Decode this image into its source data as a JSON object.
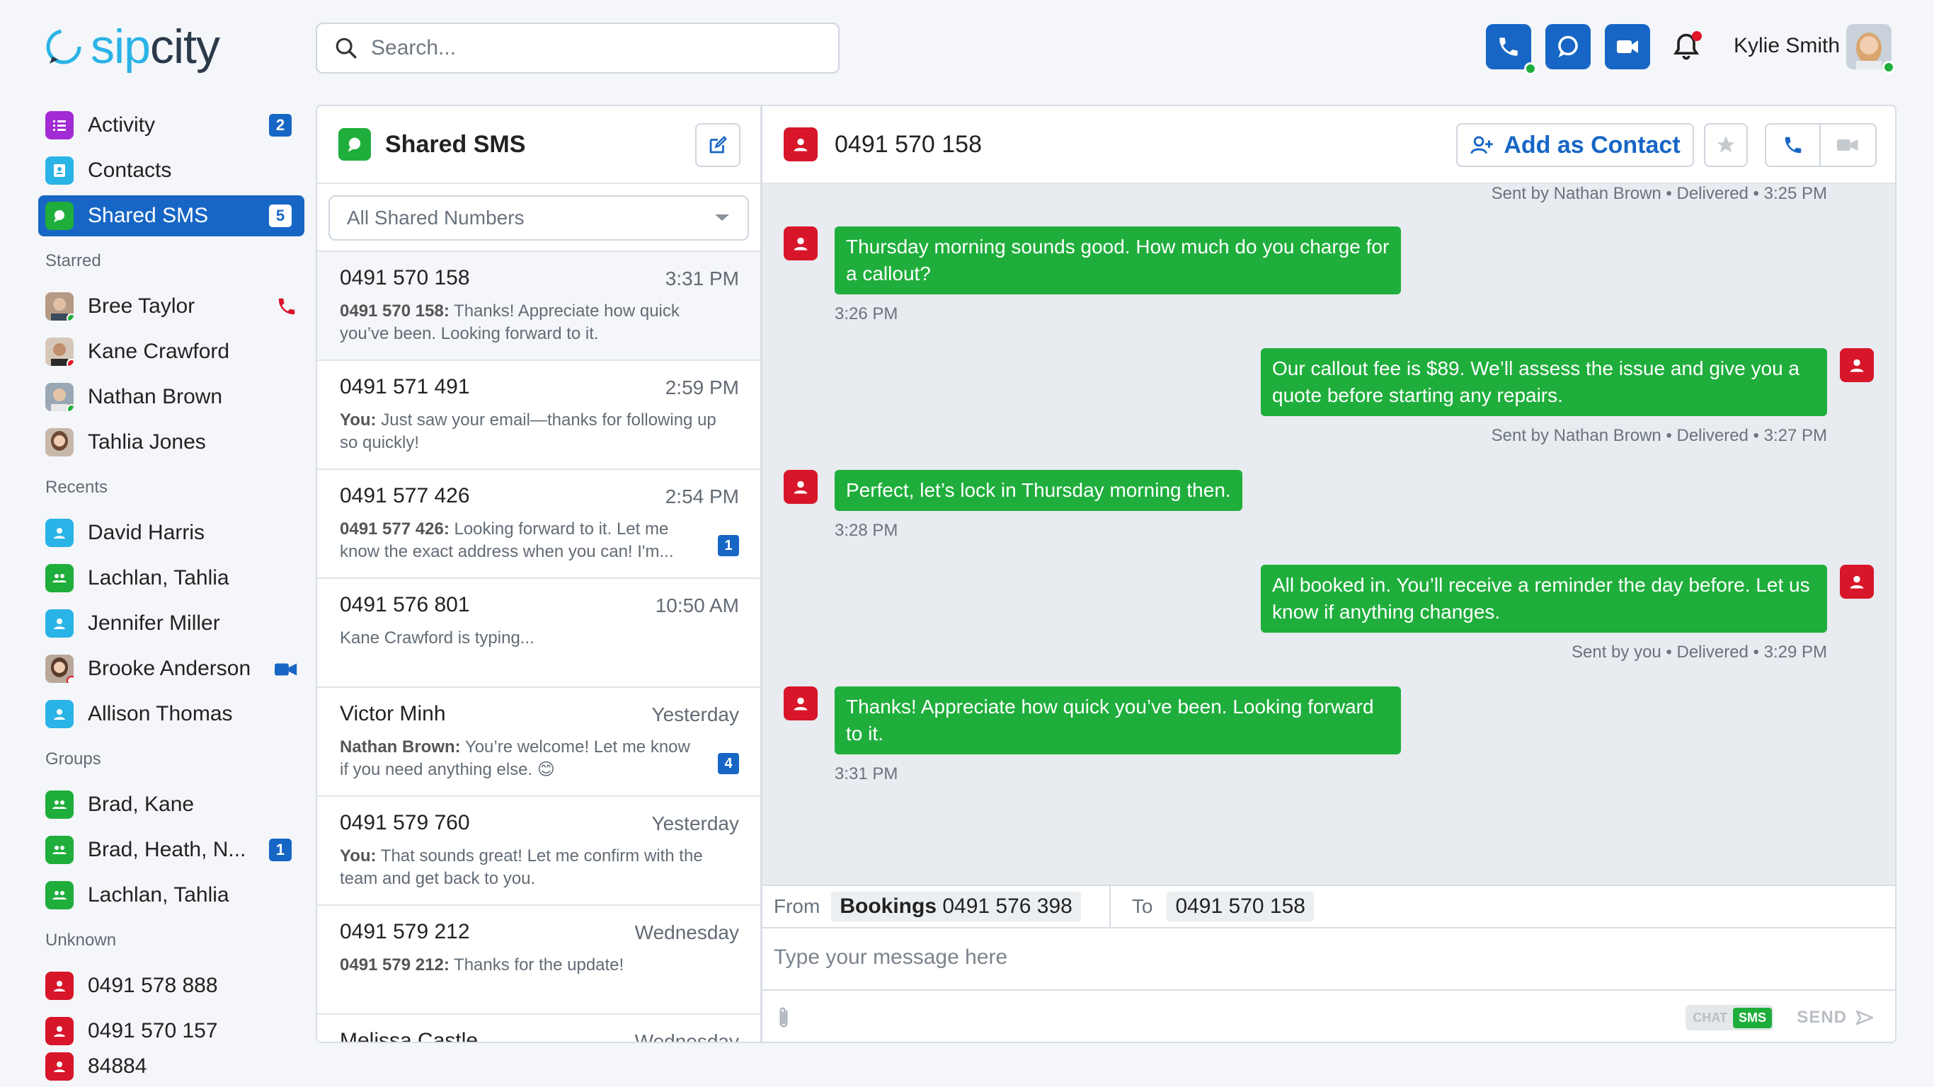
{
  "app": {
    "brand_prefix": "sip",
    "brand_suffix": "city"
  },
  "search": {
    "placeholder": "Search..."
  },
  "user": {
    "name": "Kylie Smith"
  },
  "colors": {
    "primary": "#1766c5",
    "green": "#1fae3c",
    "red": "#d8162a",
    "purple": "#a22bd6",
    "cyan": "#2ab3e6"
  },
  "sidebar": {
    "nav": [
      {
        "label": "Activity",
        "badge": "2",
        "icon": "activity-icon"
      },
      {
        "label": "Contacts",
        "icon": "contacts-icon"
      },
      {
        "label": "Shared SMS",
        "badge": "5",
        "icon": "shared-sms-icon"
      }
    ],
    "starred_heading": "Starred",
    "starred": [
      {
        "label": "Bree Taylor",
        "status": "online",
        "status_icon": "phone-icon"
      },
      {
        "label": "Kane Crawford",
        "status": "busy"
      },
      {
        "label": "Nathan Brown",
        "status": "online"
      },
      {
        "label": "Tahlia Jones",
        "status": "none"
      }
    ],
    "recents_heading": "Recents",
    "recents": [
      {
        "label": "David Harris",
        "icon": "person-icon"
      },
      {
        "label": "Lachlan, Tahlia",
        "icon": "group-icon"
      },
      {
        "label": "Jennifer Miller",
        "icon": "person-icon"
      },
      {
        "label": "Brooke Anderson",
        "icon": "avatar",
        "status_icon": "video-icon"
      },
      {
        "label": "Allison Thomas",
        "icon": "person-icon"
      }
    ],
    "groups_heading": "Groups",
    "groups": [
      {
        "label": "Brad, Kane"
      },
      {
        "label": "Brad, Heath, N...",
        "badge": "1"
      },
      {
        "label": "Lachlan, Tahlia"
      }
    ],
    "unknown_heading": "Unknown",
    "unknown": [
      {
        "label": "0491 578 888"
      },
      {
        "label": "0491 570 157"
      },
      {
        "label": "84884"
      }
    ]
  },
  "list": {
    "title": "Shared SMS",
    "filter": "All Shared Numbers",
    "conversations": [
      {
        "number": "0491 570 158",
        "time": "3:31 PM",
        "sender": "0491 570 158:",
        "text": "Thanks! Appreciate how quick you’ve been. Looking forward to it.",
        "selected": true
      },
      {
        "number": "0491 571 491",
        "time": "2:59 PM",
        "sender": "You:",
        "text": "Just saw your email—thanks for following up so quickly!"
      },
      {
        "number": "0491 577 426",
        "time": "2:54 PM",
        "sender": "0491 577 426:",
        "text": "Looking forward to it. Let me know the exact address when you can! I'm...",
        "badge": "1"
      },
      {
        "number": "0491 576 801",
        "time": "10:50 AM",
        "sender": "",
        "text": "Kane Crawford is typing..."
      },
      {
        "number": "Victor Minh",
        "time": "Yesterday",
        "sender": "Nathan Brown:",
        "text": "You’re welcome! Let me know if you need anything else. 😊",
        "badge": "4"
      },
      {
        "number": "0491 579 760",
        "time": "Yesterday",
        "sender": "You:",
        "text": "That sounds great! Let me confirm with the team and get back to you."
      },
      {
        "number": "0491 579 212",
        "time": "Wednesday",
        "sender": "0491 579 212:",
        "text": "Thanks for the update!"
      },
      {
        "number": "Melissa Castle",
        "time": "Wednesday",
        "sender": "",
        "text": ""
      }
    ]
  },
  "chat": {
    "title": "0491 570 158",
    "add_contact": "Add as Contact",
    "top_meta": "Sent by Nathan Brown • Delivered • 3:25 PM",
    "messages": [
      {
        "dir": "in",
        "text": "Thursday morning sounds good. How much do you charge for a callout?",
        "meta": "3:26 PM"
      },
      {
        "dir": "out",
        "text": "Our callout fee is $89. We’ll assess the issue and give you a quote before starting any repairs.",
        "meta": "Sent by Nathan Brown • Delivered • 3:27 PM"
      },
      {
        "dir": "in",
        "text": "Perfect, let’s lock in Thursday morning then.",
        "meta": "3:28 PM"
      },
      {
        "dir": "out",
        "text": "All booked in. You’ll receive a reminder the day before. Let us know if anything changes.",
        "meta": "Sent by you • Delivered • 3:29 PM"
      },
      {
        "dir": "in",
        "text": "Thanks! Appreciate how quick you’ve been. Looking forward to it.",
        "meta": "3:31 PM"
      }
    ],
    "from_label": "From",
    "from_name": "Bookings",
    "from_number": "0491 576 398",
    "to_label": "To",
    "to_number": "0491 570 158",
    "placeholder": "Type your message here",
    "toggle_chat": "CHAT",
    "toggle_sms": "SMS",
    "send": "SEND"
  }
}
